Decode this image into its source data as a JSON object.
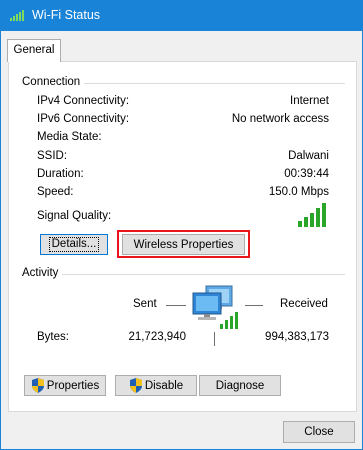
{
  "window": {
    "title": "Wi-Fi Status"
  },
  "tabs": [
    {
      "label": "General",
      "selected": true
    }
  ],
  "connection": {
    "group_label": "Connection",
    "rows": [
      {
        "label": "IPv4 Connectivity:",
        "value": "Internet"
      },
      {
        "label": "IPv6 Connectivity:",
        "value": "No network access"
      },
      {
        "label": "Media State:",
        "value": ""
      },
      {
        "label": "SSID:",
        "value": "Dalwani"
      },
      {
        "label": "Duration:",
        "value": "00:39:44"
      },
      {
        "label": "Speed:",
        "value": "150.0 Mbps"
      }
    ],
    "signal_quality_label": "Signal Quality:",
    "signal_bars_lit": 5,
    "details_button": "Details...",
    "wireless_properties_button": "Wireless Properties"
  },
  "activity": {
    "group_label": "Activity",
    "sent_label": "Sent",
    "received_label": "Received",
    "bytes_label": "Bytes:",
    "bytes_sent": "21,723,940",
    "bytes_received": "994,383,173"
  },
  "buttons": {
    "properties": "Properties",
    "disable": "Disable",
    "diagnose": "Diagnose",
    "close": "Close"
  },
  "colors": {
    "titlebar": "#1883d7",
    "signal_green": "#2aa52a",
    "highlight_red": "#e8151b",
    "focus_blue": "#0078d7"
  },
  "icons": {
    "title": "wifi-signal-icon",
    "network": "network-computers-icon",
    "shield": "uac-shield-icon"
  }
}
